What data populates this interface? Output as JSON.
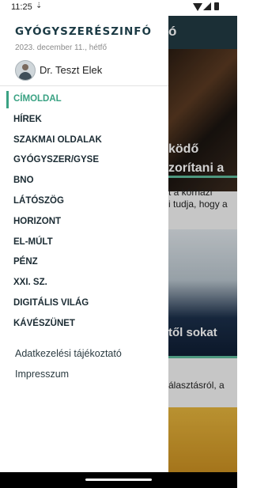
{
  "status": {
    "time": "11:25",
    "download_icon": "download-arrow-icon"
  },
  "background": {
    "header_fragment": "ó",
    "headline_lines": [
      "ködő",
      "zorítani a"
    ],
    "snippet_lines": [
      "t a kórházi",
      "i tudja, hogy a"
    ],
    "headline2": "től sokat",
    "snippet2": "álasztásról, a"
  },
  "drawer": {
    "logo": "GYÓGYSZERÉSZINFÓ",
    "date": "2023. december 11., hétfő",
    "user": "Dr. Teszt Elek",
    "menu": [
      "CÍMOLDAL",
      "HÍREK",
      "SZAKMAI OLDALAK",
      "GYÓGYSZER/GYSE",
      "BNO",
      "LÁTÓSZÖG",
      "HORIZONT",
      "EL-MÚLT",
      "PÉNZ",
      "XXI. SZ.",
      "DIGITÁLIS VILÁG",
      "KÁVÉSZÜNET"
    ],
    "links": [
      "Adatkezelési tájékoztató",
      "Impresszum"
    ]
  },
  "colors": {
    "accent": "#3aa283",
    "brand_dark": "#1b3a44"
  }
}
